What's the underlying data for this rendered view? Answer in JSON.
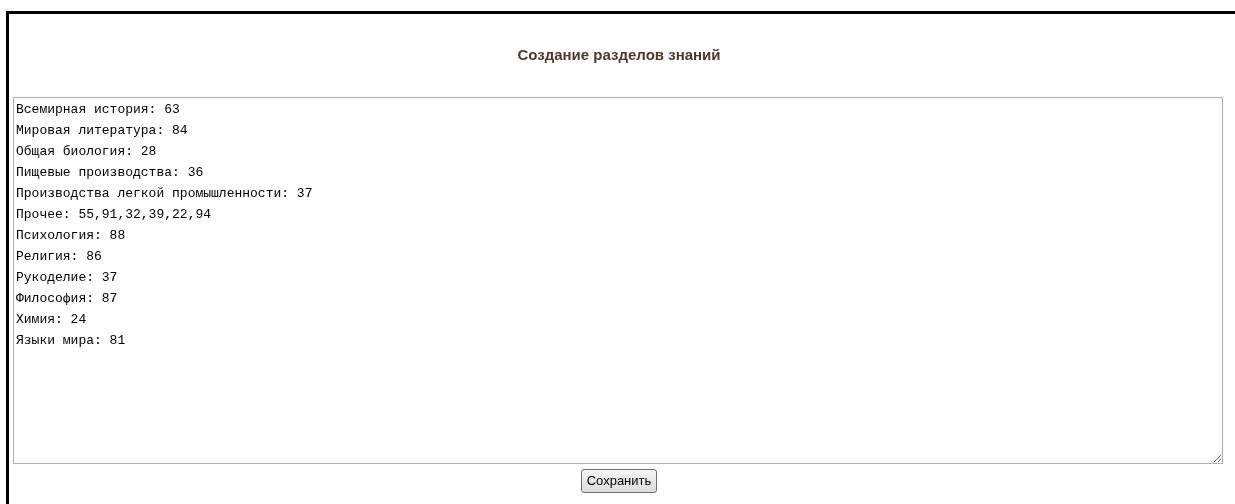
{
  "title": "Создание разделов знаний",
  "sections_text": [
    "Всемирная история: 63",
    "Мировая литература: 84",
    "Общая биология: 28",
    "Пищевые производства: 36",
    "Производства легкой промышленности: 37",
    "Прочее: 55,91,32,39,22,94",
    "Психология: 88",
    "Религия: 86",
    "Рукоделие: 37",
    "Философия: 87",
    "Химия: 24",
    "Языки мира: 81"
  ],
  "save_button": "Сохранить"
}
